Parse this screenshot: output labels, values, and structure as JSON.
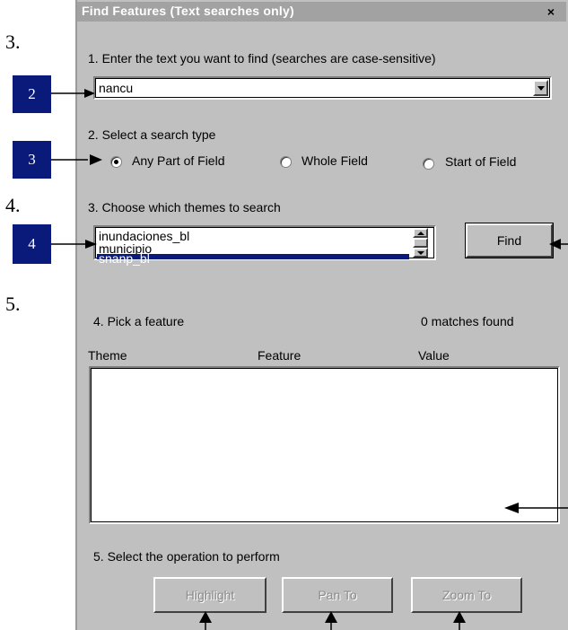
{
  "doc_numbers": [
    "3.",
    "4.",
    "5."
  ],
  "callouts": [
    "2",
    "3",
    "4"
  ],
  "dialog": {
    "title": "Find Features (Text searches only)",
    "close_glyph": "×",
    "step1": {
      "label": "1. Enter the text you want to find (searches are case-sensitive)",
      "value": "nancu"
    },
    "step2": {
      "label": "2. Select a search type",
      "options": [
        "Any Part of Field",
        "Whole Field",
        "Start of Field"
      ],
      "selected": "Any Part of Field"
    },
    "step3": {
      "label": "3. Choose which themes to search",
      "themes": [
        "inundaciones_bl",
        "municipio",
        "snanp_bl"
      ],
      "selected": "snanp_bl"
    },
    "find_button": "Find",
    "step4": {
      "label": "4. Pick a feature",
      "matches": "0 matches found",
      "columns": [
        "Theme",
        "Feature",
        "Value"
      ]
    },
    "step5": {
      "label": "5. Select the operation to perform",
      "buttons": [
        "Highlight",
        "Pan To",
        "Zoom To"
      ]
    }
  },
  "colors": {
    "callout_bg": "#0a1a7a",
    "selection": "#0a1a7a",
    "panel": "#c0c0c0",
    "titlebar": "#a2a2a2"
  },
  "icons": [
    "close-icon",
    "dropdown-arrow-icon",
    "scroll-up-icon",
    "scroll-down-icon",
    "radio-icon",
    "arrow-icon"
  ]
}
